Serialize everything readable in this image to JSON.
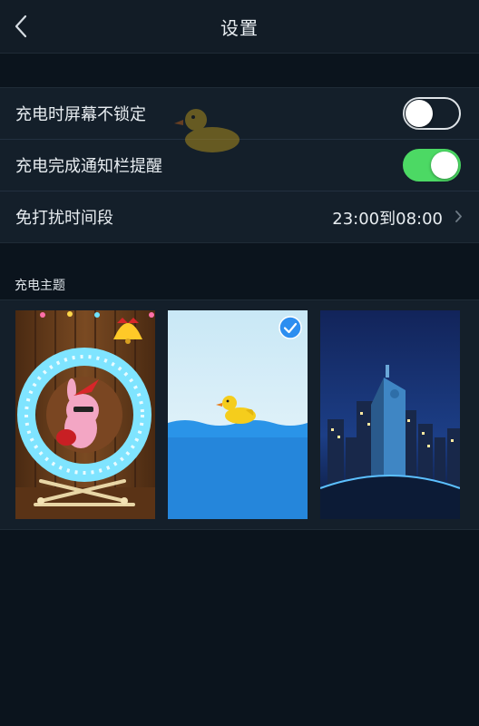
{
  "header": {
    "title": "设置",
    "back_icon": "chevron-left-icon"
  },
  "settings": {
    "rows": [
      {
        "label": "充电时屏幕不锁定",
        "toggle": false
      },
      {
        "label": "充电完成通知栏提醒",
        "toggle": true
      },
      {
        "label": "免打扰时间段",
        "value": "23:00到08:00"
      }
    ]
  },
  "themes": {
    "section_label": "充电主题",
    "items": [
      {
        "name": "bunny-wheel-theme",
        "selected": false
      },
      {
        "name": "duck-water-theme",
        "selected": true
      },
      {
        "name": "city-night-theme",
        "selected": false
      }
    ]
  },
  "colors": {
    "background": "#0b141d",
    "panel": "#141f2a",
    "toggle_on": "#4cd964",
    "check_badge": "#2d8ef0"
  }
}
